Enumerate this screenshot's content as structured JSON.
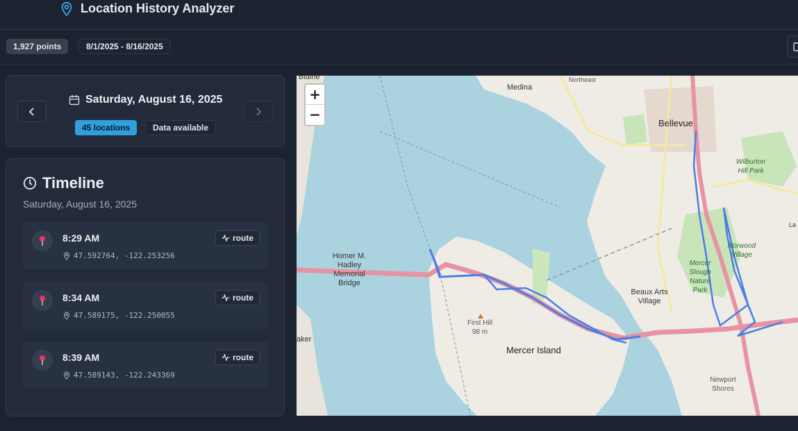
{
  "app": {
    "title": "Location History Analyzer"
  },
  "summary": {
    "points": "1,927 points",
    "date_range": "8/1/2025 - 8/16/2025"
  },
  "date_nav": {
    "date": "Saturday, August 16, 2025",
    "locations_badge": "45 locations",
    "availability_badge": "Data available"
  },
  "timeline": {
    "title": "Timeline",
    "subtitle": "Saturday, August 16, 2025",
    "entries": [
      {
        "time": "8:29 AM",
        "coords": "47.592764, -122.253256",
        "action": "route"
      },
      {
        "time": "8:34 AM",
        "coords": "47.589175, -122.250055",
        "action": "route"
      },
      {
        "time": "8:39 AM",
        "coords": "47.589143, -122.243369",
        "action": "route"
      }
    ]
  },
  "map": {
    "zoom_in": "+",
    "zoom_out": "−",
    "labels": {
      "medina": "Medina",
      "bellevue": "Bellevue",
      "bridge": "Homer M. Hadley Memorial Bridge",
      "first_hill": "First Hill 98 m",
      "mercer_island": "Mercer Island",
      "beaux_arts": "Beaux Arts Village",
      "wilburton": "Wilburton Hill Park",
      "norwood": "Norwood Village",
      "mercer_slough": "Mercer Slough Nature Park",
      "newport": "Newport Shores",
      "blaine": "Blaine",
      "laker": "aker",
      "northeast": "Northeast",
      "la": "La"
    },
    "route_color": "#4a7ee6",
    "water_color": "#aad3df",
    "land_color": "#f2efe9",
    "highway_color": "#e892a2"
  },
  "colors": {
    "accent": "#2f9fe0",
    "pin": "#e8365d"
  }
}
